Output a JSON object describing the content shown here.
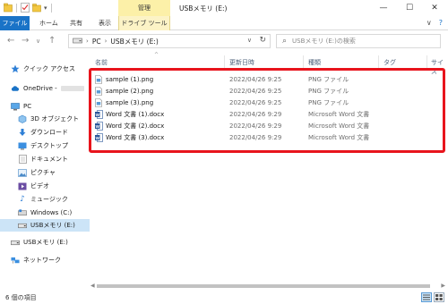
{
  "window": {
    "title": "USBメモリ (E:)"
  },
  "title_bar": {
    "manage_tab": "管理",
    "minimize_glyph": "—",
    "maximize_glyph": "☐",
    "close_glyph": "✕",
    "qat_dropdown_glyph": "▾"
  },
  "ribbon": {
    "tabs": [
      "ファイル",
      "ホーム",
      "共有",
      "表示",
      "ドライブ ツール"
    ],
    "expand_glyph": "∨",
    "help_glyph": "?"
  },
  "navigation": {
    "back_glyph": "←",
    "forward_glyph": "→",
    "recent_glyph": "∨",
    "up_glyph": "↑",
    "address_breadcrumb": [
      "PC",
      "USBメモリ (E:)"
    ],
    "breadcrumb_separator": "›",
    "address_dropdown_glyph": "∨",
    "refresh_glyph": "↻",
    "search_placeholder": "USBメモリ (E:)の検索",
    "search_icon_glyph": "⌕"
  },
  "nav_pane": {
    "quick_access": "クイック アクセス",
    "onedrive": "OneDrive -",
    "pc": "PC",
    "pc_children": [
      "3D オブジェクト",
      "ダウンロード",
      "デスクトップ",
      "ドキュメント",
      "ピクチャ",
      "ビデオ",
      "ミュージック",
      "Windows (C:)",
      "USBメモリ (E:)"
    ],
    "usb_drive": "USBメモリ (E:)",
    "network": "ネットワーク"
  },
  "columns": {
    "name": "名前",
    "modified": "更新日時",
    "type": "種類",
    "tags": "タグ",
    "size": "サイズ",
    "sort_glyph": "^"
  },
  "files": [
    {
      "name": "sample (1).png",
      "modified": "2022/04/26 9:25",
      "type": "PNG ファイル",
      "icon": "png-file-icon"
    },
    {
      "name": "sample (2).png",
      "modified": "2022/04/26 9:25",
      "type": "PNG ファイル",
      "icon": "png-file-icon"
    },
    {
      "name": "sample (3).png",
      "modified": "2022/04/26 9:25",
      "type": "PNG ファイル",
      "icon": "png-file-icon"
    },
    {
      "name": "Word 文書 (1).docx",
      "modified": "2022/04/26 9:29",
      "type": "Microsoft Word 文書",
      "icon": "word-file-icon"
    },
    {
      "name": "Word 文書 (2).docx",
      "modified": "2022/04/26 9:29",
      "type": "Microsoft Word 文書",
      "icon": "word-file-icon"
    },
    {
      "name": "Word 文書 (3).docx",
      "modified": "2022/04/26 9:29",
      "type": "Microsoft Word 文書",
      "icon": "word-file-icon"
    }
  ],
  "status": {
    "item_count": "6 個の項目"
  },
  "colors": {
    "file_tab": "#1a73c7",
    "manage_band": "#fcf0a8",
    "highlight_box": "#e8141c",
    "selected_nav": "#cce4f7",
    "column_header_text": "#4c607a"
  }
}
